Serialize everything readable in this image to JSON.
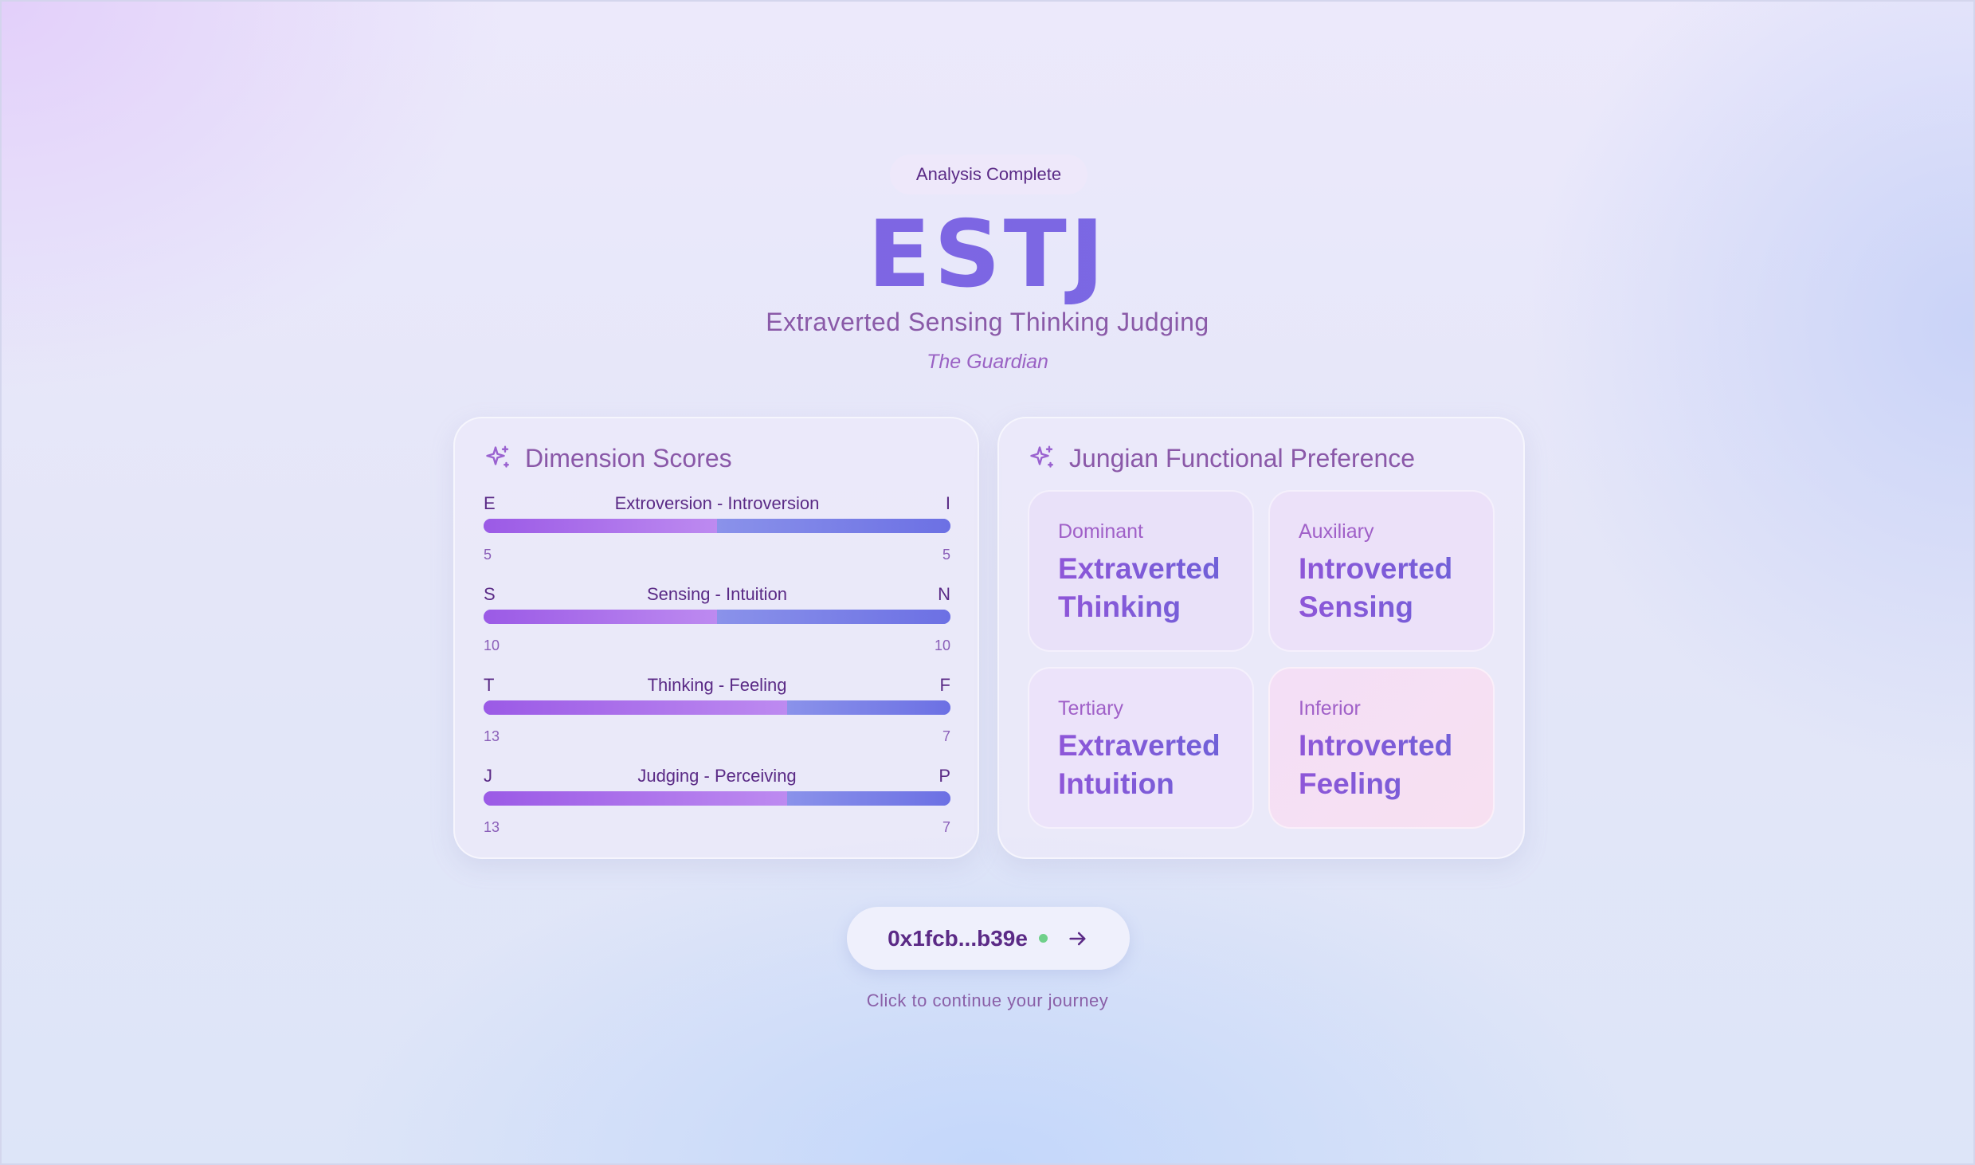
{
  "badge": "Analysis Complete",
  "type_code": "ESTJ",
  "type_full": "Extraverted Sensing Thinking Judging",
  "nickname": "The Guardian",
  "dimension_card": {
    "title": "Dimension Scores",
    "icon": "sparkles-icon",
    "dimensions": [
      {
        "left": "E",
        "label": "Extroversion - Introversion",
        "right": "I",
        "left_score": "5",
        "right_score": "5",
        "left_fraction": 0.5
      },
      {
        "left": "S",
        "label": "Sensing - Intuition",
        "right": "N",
        "left_score": "10",
        "right_score": "10",
        "left_fraction": 0.5
      },
      {
        "left": "T",
        "label": "Thinking - Feeling",
        "right": "F",
        "left_score": "13",
        "right_score": "7",
        "left_fraction": 0.65
      },
      {
        "left": "J",
        "label": "Judging - Perceiving",
        "right": "P",
        "left_score": "13",
        "right_score": "7",
        "left_fraction": 0.65
      }
    ]
  },
  "function_card": {
    "title": "Jungian Functional Preference",
    "icon": "sparkles-icon",
    "functions": {
      "dominant": {
        "label": "Dominant",
        "line1": "Extraverted",
        "line2": "Thinking"
      },
      "auxiliary": {
        "label": "Auxiliary",
        "line1": "Introverted",
        "line2": "Sensing"
      },
      "tertiary": {
        "label": "Tertiary",
        "line1": "Extraverted",
        "line2": "Intuition"
      },
      "inferior": {
        "label": "Inferior",
        "line1": "Introverted",
        "line2": "Feeling"
      }
    }
  },
  "wallet": {
    "address": "0x1fcb...b39e",
    "status_color": "#6fd08a",
    "icon": "arrow-right-icon"
  },
  "hint": "Click to continue your journey",
  "colors": {
    "accent_purple": "#8a5ee0",
    "accent_indigo": "#6f6fe6"
  }
}
